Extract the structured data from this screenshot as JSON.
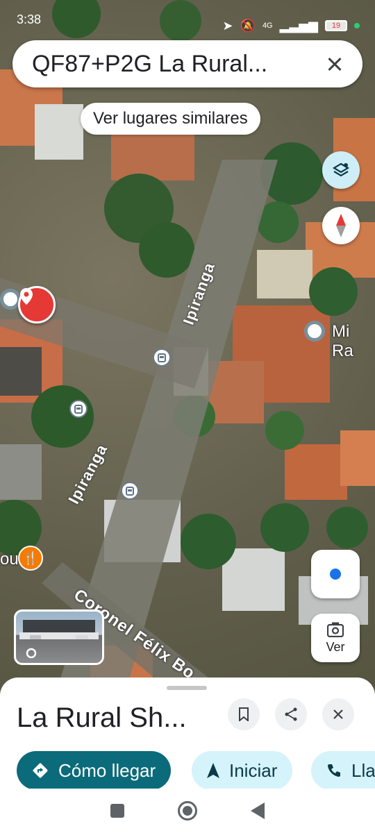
{
  "status": {
    "time": "3:38",
    "network": "4G",
    "battery": "19"
  },
  "search": {
    "query": "QF87+P2G La Rural..."
  },
  "chip": {
    "label": "Ver lugares similares"
  },
  "map": {
    "streets": {
      "ipiranga_upper": "Ipiranga",
      "ipiranga_lower": "Ipiranga",
      "coronel": "Coronel Félix Bo"
    },
    "poi_mi": "Mi Ra",
    "poi_left": "ou"
  },
  "controls": {
    "ver_label": "Ver"
  },
  "sheet": {
    "title": "La Rural Sh...",
    "actions": {
      "route": "Cómo llegar",
      "start": "Iniciar",
      "call": "Lla"
    }
  }
}
